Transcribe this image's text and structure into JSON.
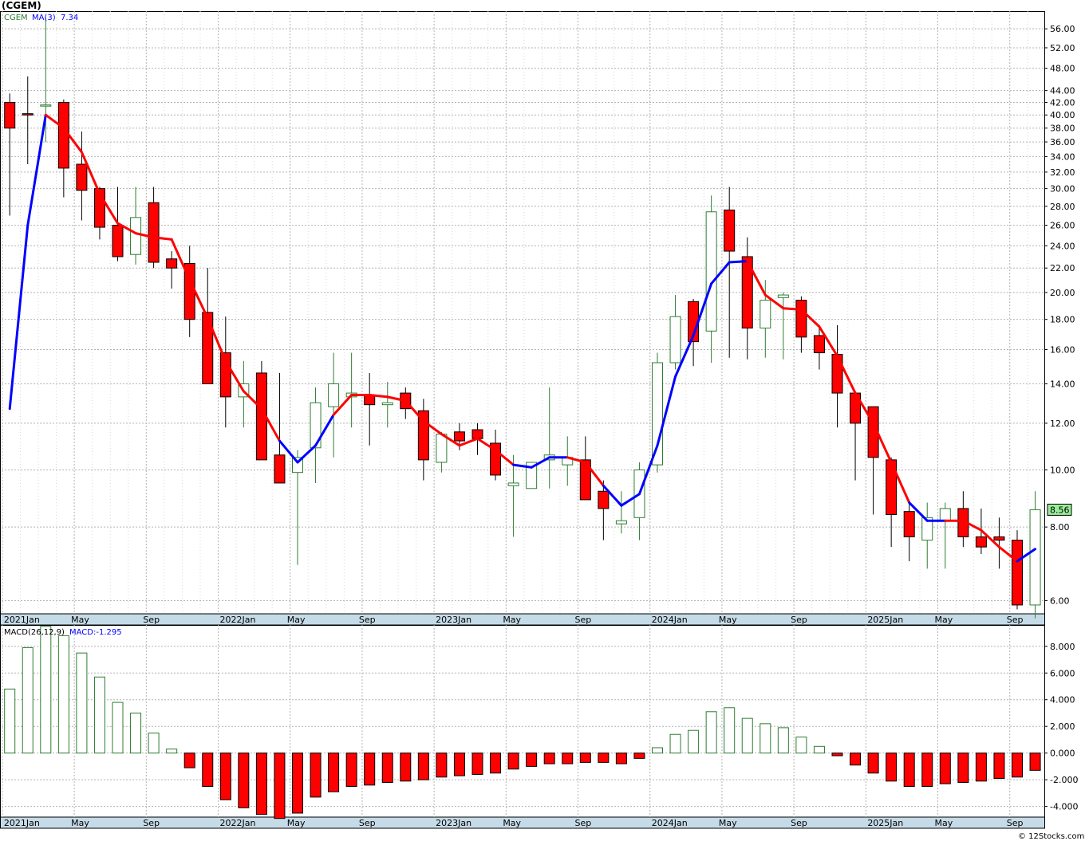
{
  "header": {
    "ticker_label": "(CGEM)"
  },
  "price_panel": {
    "legend_symbol": "CGEM",
    "legend_ma": "MA(3)",
    "legend_ma_value": "7.34",
    "last_price_label": "8.56",
    "ticks": [
      "56.00",
      "52.00",
      "48.00",
      "44.00",
      "42.00",
      "40.00",
      "38.00",
      "36.00",
      "34.00",
      "32.00",
      "30.00",
      "28.00",
      "26.00",
      "24.00",
      "22.00",
      "20.00",
      "18.00",
      "16.00",
      "14.00",
      "12.00",
      "10.00",
      "8.00",
      "6.00"
    ]
  },
  "macd_panel": {
    "legend_name": "MACD(26,12,9)",
    "legend_value": "MACD:-1.295",
    "ticks": [
      "8.000",
      "6.000",
      "4.000",
      "2.000",
      "0.000",
      "-2.000",
      "-4.000"
    ]
  },
  "x_axis": {
    "labels": [
      "2021Jan",
      "May",
      "Sep",
      "2022Jan",
      "May",
      "Sep",
      "2023Jan",
      "May",
      "Sep",
      "2024Jan",
      "May",
      "Sep",
      "2025Jan",
      "May",
      "Sep"
    ]
  },
  "watermark": "© 12Stocks.com",
  "colors": {
    "up_candle": "#2e7d32",
    "down_candle": "#ff0000",
    "ma_down": "#ff0000",
    "ma_up": "#0000ff",
    "axis_band": "#c6dbe8",
    "grid": "#b4b4b4",
    "last_price_bg": "#99ee99"
  },
  "chart_data": [
    {
      "type": "candlestick",
      "title": "(CGEM)",
      "scale": "log",
      "ylim": [
        5.7,
        60
      ],
      "interval": "monthly",
      "x": [
        "2021-01",
        "2021-02",
        "2021-03",
        "2021-04",
        "2021-05",
        "2021-06",
        "2021-07",
        "2021-08",
        "2021-09",
        "2021-10",
        "2021-11",
        "2021-12",
        "2022-01",
        "2022-02",
        "2022-03",
        "2022-04",
        "2022-05",
        "2022-06",
        "2022-07",
        "2022-08",
        "2022-09",
        "2022-10",
        "2022-11",
        "2022-12",
        "2023-01",
        "2023-02",
        "2023-03",
        "2023-04",
        "2023-05",
        "2023-06",
        "2023-07",
        "2023-08",
        "2023-09",
        "2023-10",
        "2023-11",
        "2023-12",
        "2024-01",
        "2024-02",
        "2024-03",
        "2024-04",
        "2024-05",
        "2024-06",
        "2024-07",
        "2024-08",
        "2024-09",
        "2024-10",
        "2024-11",
        "2024-12",
        "2025-01",
        "2025-02",
        "2025-03",
        "2025-04",
        "2025-05",
        "2025-06",
        "2025-07",
        "2025-08",
        "2025-09",
        "2025-10"
      ],
      "open": [
        42.0,
        40.2,
        41.6,
        42.0,
        33.0,
        30.0,
        26.0,
        23.2,
        28.4,
        22.8,
        22.4,
        18.5,
        15.8,
        13.3,
        14.6,
        10.6,
        9.9,
        10.9,
        12.8,
        13.3,
        13.4,
        12.9,
        13.5,
        12.6,
        10.3,
        11.6,
        11.7,
        11.1,
        9.4,
        9.3,
        10.4,
        10.2,
        10.4,
        9.2,
        8.1,
        8.3,
        10.2,
        15.2,
        19.3,
        17.2,
        27.6,
        23.0,
        17.4,
        19.6,
        19.4,
        16.9,
        15.7,
        13.5,
        12.8,
        10.4,
        8.5,
        7.6,
        8.2,
        8.6,
        7.7,
        7.7,
        7.6,
        5.9
      ],
      "high": [
        43.5,
        46.5,
        58.5,
        42.5,
        37.5,
        30.2,
        30.2,
        30.2,
        30.2,
        23.5,
        24.0,
        22.0,
        18.2,
        15.3,
        15.3,
        14.6,
        10.8,
        13.8,
        15.8,
        15.8,
        14.6,
        14.1,
        13.8,
        13.2,
        11.6,
        12.0,
        12.0,
        11.7,
        10.6,
        9.8,
        13.8,
        11.4,
        11.4,
        9.6,
        9.2,
        10.3,
        15.8,
        19.8,
        19.5,
        29.2,
        30.2,
        24.8,
        21.0,
        20.0,
        19.7,
        17.6,
        17.6,
        13.6,
        12.8,
        10.5,
        8.8,
        8.8,
        8.8,
        9.2,
        8.6,
        8.3,
        7.9,
        9.2
      ],
      "low": [
        27.0,
        33.0,
        36.0,
        29.0,
        26.5,
        24.6,
        22.6,
        22.3,
        22.0,
        20.3,
        16.8,
        14.4,
        11.8,
        11.8,
        10.6,
        9.5,
        6.9,
        9.5,
        10.5,
        11.8,
        11.0,
        11.8,
        12.2,
        9.6,
        9.9,
        10.8,
        10.6,
        9.6,
        7.7,
        9.3,
        9.3,
        9.4,
        9.1,
        7.6,
        7.8,
        7.6,
        9.9,
        14.8,
        15.0,
        15.2,
        15.5,
        15.4,
        15.5,
        15.4,
        15.8,
        14.8,
        11.8,
        9.6,
        8.4,
        7.4,
        7.0,
        6.8,
        6.8,
        7.4,
        7.2,
        6.8,
        5.8,
        5.6
      ],
      "close": [
        38.0,
        40.0,
        41.6,
        32.5,
        29.8,
        25.8,
        23.0,
        26.8,
        22.5,
        22.0,
        18.0,
        14.0,
        13.3,
        14.0,
        10.4,
        9.5,
        10.5,
        13.0,
        14.0,
        13.5,
        12.9,
        13.0,
        12.7,
        10.4,
        11.5,
        11.2,
        11.3,
        9.8,
        9.5,
        10.3,
        10.6,
        10.5,
        8.9,
        8.6,
        8.2,
        10.0,
        15.2,
        18.2,
        16.5,
        27.4,
        23.5,
        17.4,
        19.4,
        19.8,
        16.8,
        15.8,
        13.5,
        12.0,
        10.5,
        8.4,
        7.7,
        8.3,
        8.6,
        7.7,
        7.4,
        7.6,
        5.9,
        8.56
      ],
      "ma3": [
        12.7,
        26.0,
        40.0,
        38.0,
        34.6,
        29.4,
        26.2,
        25.2,
        24.8,
        24.6,
        21.0,
        18.1,
        15.3,
        13.6,
        12.7,
        11.2,
        10.3,
        11.0,
        12.4,
        13.4,
        13.4,
        13.3,
        13.1,
        12.1,
        11.5,
        11.0,
        11.3,
        10.8,
        10.2,
        10.1,
        10.5,
        10.5,
        10.3,
        9.4,
        8.7,
        9.1,
        11.0,
        14.4,
        16.9,
        20.7,
        22.5,
        22.6,
        19.8,
        18.8,
        18.7,
        17.5,
        15.6,
        13.5,
        12.0,
        10.3,
        8.8,
        8.2,
        8.2,
        8.2,
        7.9,
        7.4,
        7.0,
        7.34
      ],
      "ma3_up": [
        true,
        true,
        true,
        false,
        false,
        false,
        false,
        false,
        false,
        false,
        false,
        false,
        false,
        false,
        false,
        false,
        true,
        true,
        true,
        false,
        false,
        false,
        false,
        false,
        false,
        false,
        false,
        false,
        false,
        true,
        true,
        true,
        false,
        false,
        true,
        true,
        true,
        true,
        true,
        true,
        true,
        true,
        false,
        false,
        false,
        false,
        false,
        false,
        false,
        false,
        false,
        true,
        true,
        false,
        false,
        false,
        false,
        true
      ]
    },
    {
      "type": "bar",
      "title": "MACD(26,12,9)",
      "ylim": [
        -4.8,
        9.6
      ],
      "x": [
        "2021-01",
        "2021-02",
        "2021-03",
        "2021-04",
        "2021-05",
        "2021-06",
        "2021-07",
        "2021-08",
        "2021-09",
        "2021-10",
        "2021-11",
        "2021-12",
        "2022-01",
        "2022-02",
        "2022-03",
        "2022-04",
        "2022-05",
        "2022-06",
        "2022-07",
        "2022-08",
        "2022-09",
        "2022-10",
        "2022-11",
        "2022-12",
        "2023-01",
        "2023-02",
        "2023-03",
        "2023-04",
        "2023-05",
        "2023-06",
        "2023-07",
        "2023-08",
        "2023-09",
        "2023-10",
        "2023-11",
        "2023-12",
        "2024-01",
        "2024-02",
        "2024-03",
        "2024-04",
        "2024-05",
        "2024-06",
        "2024-07",
        "2024-08",
        "2024-09",
        "2024-10",
        "2024-11",
        "2024-12",
        "2025-01",
        "2025-02",
        "2025-03",
        "2025-04",
        "2025-05",
        "2025-06",
        "2025-07",
        "2025-08",
        "2025-09",
        "2025-10"
      ],
      "values": [
        4.8,
        7.9,
        9.5,
        8.8,
        7.5,
        5.7,
        3.8,
        3.0,
        1.5,
        0.3,
        -1.1,
        -2.5,
        -3.5,
        -4.1,
        -4.6,
        -4.9,
        -4.5,
        -3.3,
        -2.9,
        -2.5,
        -2.4,
        -2.2,
        -2.1,
        -2.0,
        -1.8,
        -1.7,
        -1.6,
        -1.5,
        -1.2,
        -1.0,
        -0.8,
        -0.8,
        -0.7,
        -0.7,
        -0.8,
        -0.4,
        0.4,
        1.4,
        1.7,
        3.1,
        3.4,
        2.6,
        2.2,
        1.9,
        1.2,
        0.5,
        -0.2,
        -0.9,
        -1.5,
        -2.1,
        -2.5,
        -2.5,
        -2.3,
        -2.2,
        -2.1,
        -1.9,
        -1.8,
        -1.295
      ]
    }
  ]
}
